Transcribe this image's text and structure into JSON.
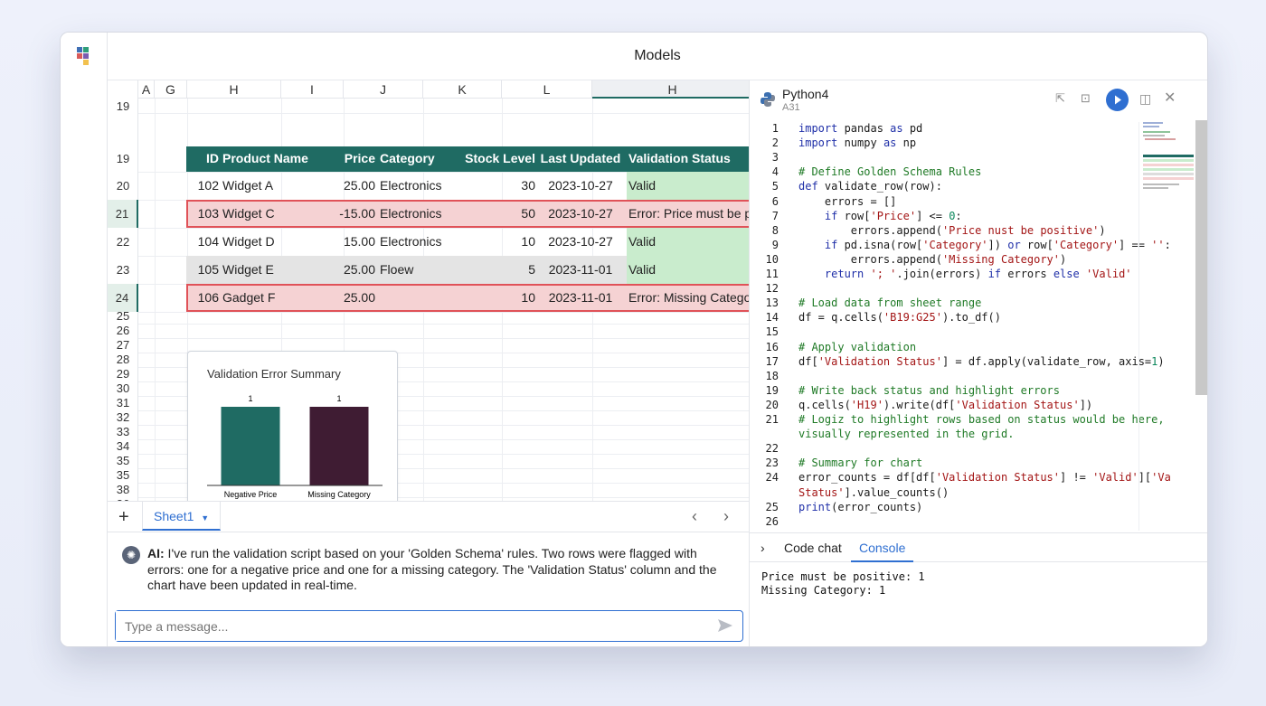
{
  "window": {
    "title": "Models"
  },
  "sheet": {
    "columns": [
      "A",
      "G",
      "H",
      "I",
      "J",
      "K",
      "L",
      "H"
    ],
    "row_numbers": [
      "19",
      "19",
      "20",
      "21",
      "22",
      "23",
      "24",
      "25",
      "26",
      "27",
      "28",
      "29",
      "30",
      "31",
      "32",
      "33",
      "34",
      "35",
      "35",
      "38",
      "36",
      "37"
    ],
    "selected_rows": [
      "21",
      "24"
    ],
    "header": [
      "ID",
      "Product Name",
      "Price",
      "Category",
      "Stock Level",
      "Last Updated",
      "Validation Status"
    ],
    "rows": [
      {
        "id": "102",
        "name": "Widget A",
        "price": "25.00",
        "category": "Electronics",
        "stock": "30",
        "updated": "2023-10-27",
        "status": "Valid",
        "state": "valid"
      },
      {
        "id": "103",
        "name": "Widget C",
        "price": "-15.00",
        "category": "Electronics",
        "stock": "50",
        "updated": "2023-10-27",
        "status": "Error: Price must be positive.",
        "state": "error"
      },
      {
        "id": "104",
        "name": "Widget D",
        "price": "15.00",
        "category": "Electronics",
        "stock": "10",
        "updated": "2023-10-27",
        "status": "Valid",
        "state": "valid"
      },
      {
        "id": "105",
        "name": "Widget E",
        "price": "25.00",
        "category": "Floew",
        "stock": "5",
        "updated": "2023-11-01",
        "status": "Valid",
        "state": "grey"
      },
      {
        "id": "106",
        "name": "Gadget F",
        "price": "25.00",
        "category": "",
        "stock": "10",
        "updated": "2023-11-01",
        "status": "Error: Missing Category.",
        "state": "error"
      }
    ]
  },
  "chart_data": {
    "type": "bar",
    "title": "Validation Error Summary",
    "categories": [
      "Negative Price",
      "Missing Category"
    ],
    "values": [
      1,
      1
    ],
    "data_labels": [
      "1",
      "1"
    ],
    "colors": [
      "#1f6b63",
      "#3f1c33"
    ],
    "ylim": [
      0,
      1
    ],
    "grid": false,
    "legend": "none"
  },
  "tabs": {
    "add_icon": "plus-icon",
    "sheet_name": "Sheet1",
    "prev": "‹",
    "next": "›"
  },
  "chat": {
    "sender": "AI:",
    "message": " I've run the validation script based on your 'Golden Schema' rules. Two rows were flagged with errors: one for a negative price and one for a missing category. The 'Validation Status' column and the chart have been updated in real-time.",
    "placeholder": "Type a message...",
    "avatar_icon": "ai-avatar-icon",
    "send_icon": "send-icon"
  },
  "python": {
    "title": "Python4",
    "cell_ref": "A31",
    "code_lines": [
      {
        "n": "1",
        "html": "<span class=\"kw\">import</span> pandas <span class=\"kw\">as</span> pd"
      },
      {
        "n": "2",
        "html": "<span class=\"kw\">import</span> numpy <span class=\"kw\">as</span> np"
      },
      {
        "n": "3",
        "html": ""
      },
      {
        "n": "4",
        "html": "<span class=\"cm\"># Define Golden Schema Rules</span>"
      },
      {
        "n": "5",
        "html": "<span class=\"kw\">def</span> validate_row(row):"
      },
      {
        "n": "6",
        "html": "    errors = []"
      },
      {
        "n": "7",
        "html": "    <span class=\"kw\">if</span> row[<span class=\"st\">'Price'</span>] &lt;= <span class=\"nm\">0</span>:"
      },
      {
        "n": "8",
        "html": "        errors.append(<span class=\"st\">'Price nust be positive'</span>)"
      },
      {
        "n": "9",
        "html": "    <span class=\"kw\">if</span> pd.isna(row[<span class=\"st\">'Category'</span>]) <span class=\"kw\">or</span> row[<span class=\"st\">'Category'</span>] == <span class=\"st\">''</span>:"
      },
      {
        "n": "10",
        "html": "        errors.append(<span class=\"st\">'Missing Category'</span>)"
      },
      {
        "n": "11",
        "html": "    <span class=\"kw\">return</span> <span class=\"st\">'; '</span>.join(errors) <span class=\"kw\">if</span> errors <span class=\"kw\">else</span> <span class=\"st\">'Valid'</span>"
      },
      {
        "n": "12",
        "html": ""
      },
      {
        "n": "13",
        "html": "<span class=\"cm\"># Load data from sheet range</span>"
      },
      {
        "n": "14",
        "html": "df = q.cells(<span class=\"st\">'B19:G25'</span>).to_df()"
      },
      {
        "n": "15",
        "html": ""
      },
      {
        "n": "16",
        "html": "<span class=\"cm\"># Apply validation</span>"
      },
      {
        "n": "17",
        "html": "df[<span class=\"st\">'Validation Status'</span>] = df.apply(validate_row, axis=<span class=\"nm\">1</span>)"
      },
      {
        "n": "18",
        "html": ""
      },
      {
        "n": "19",
        "html": "<span class=\"cm\"># Write back status and highlight errors</span>"
      },
      {
        "n": "20",
        "html": "q.cells(<span class=\"st\">'H19'</span>).write(df[<span class=\"st\">'Validation Status'</span>])"
      },
      {
        "n": "21",
        "html": "<span class=\"cm\"># Logiz to highlight rows based on status would be here,</span>"
      },
      {
        "n": "",
        "html": "<span class=\"cm\">visually represented in the grid.</span>"
      },
      {
        "n": "22",
        "html": ""
      },
      {
        "n": "23",
        "html": "<span class=\"cm\"># Summary for chart</span>"
      },
      {
        "n": "24",
        "html": "error_counts = df[df[<span class=\"st\">'Validation Status'</span>] != <span class=\"st\">'Valid'</span>][<span class=\"st\">'Va</span>"
      },
      {
        "n": "",
        "html": "<span class=\"st\">Status'</span>].value_counts()"
      },
      {
        "n": "25",
        "html": "<span class=\"kw\">print</span>(error_counts)"
      },
      {
        "n": "26",
        "html": ""
      }
    ],
    "console_tabs": [
      "Code chat",
      "Console"
    ],
    "active_console_tab": "Console",
    "console_output": "Price must be positive: 1\nMissing Category: 1"
  }
}
